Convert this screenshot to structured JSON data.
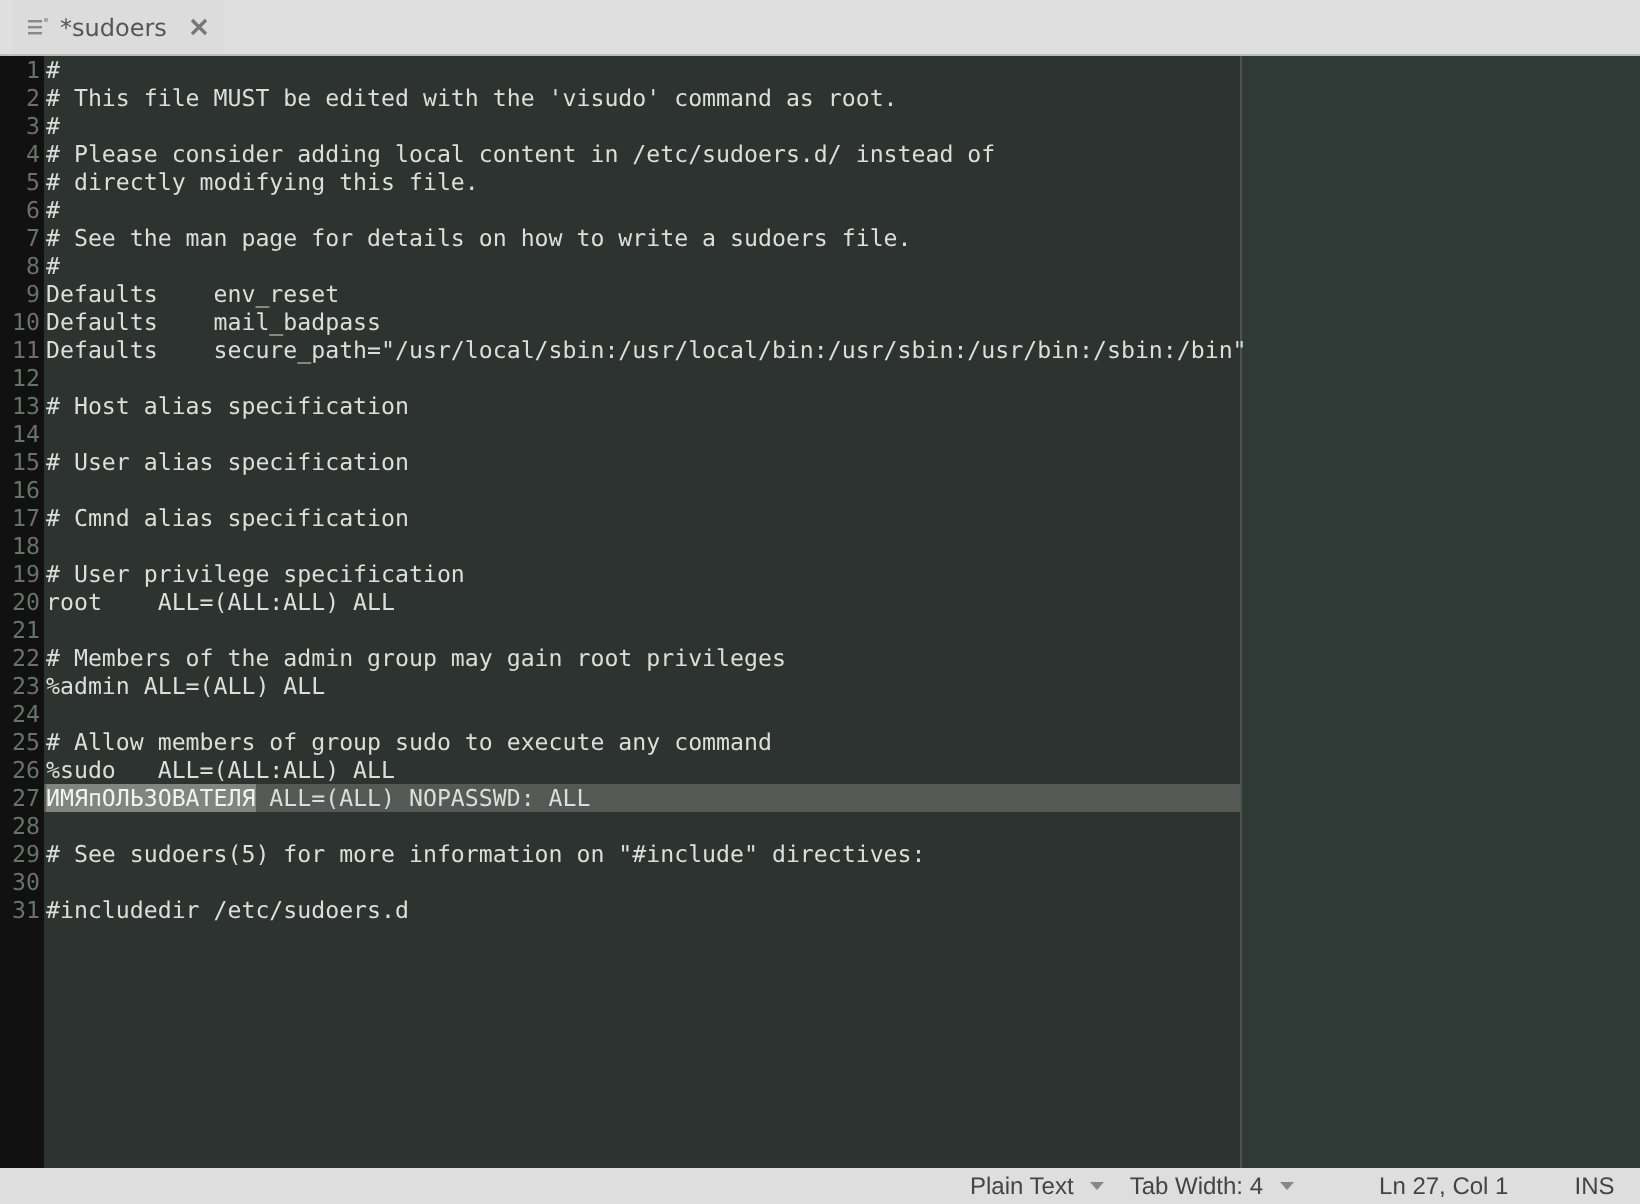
{
  "tab": {
    "title": "*sudoers",
    "modified": true
  },
  "lines": [
    {
      "number": "1",
      "text": "#",
      "current": false
    },
    {
      "number": "2",
      "text": "# This file MUST be edited with the 'visudo' command as root.",
      "current": false
    },
    {
      "number": "3",
      "text": "#",
      "current": false
    },
    {
      "number": "4",
      "text": "# Please consider adding local content in /etc/sudoers.d/ instead of",
      "current": false
    },
    {
      "number": "5",
      "text": "# directly modifying this file.",
      "current": false
    },
    {
      "number": "6",
      "text": "#",
      "current": false
    },
    {
      "number": "7",
      "text": "# See the man page for details on how to write a sudoers file.",
      "current": false
    },
    {
      "number": "8",
      "text": "#",
      "current": false
    },
    {
      "number": "9",
      "text": "Defaults    env_reset",
      "current": false
    },
    {
      "number": "10",
      "text": "Defaults    mail_badpass",
      "current": false
    },
    {
      "number": "11",
      "text": "Defaults    secure_path=\"/usr/local/sbin:/usr/local/bin:/usr/sbin:/usr/bin:/sbin:/bin\"",
      "current": false
    },
    {
      "number": "12",
      "current": false
    },
    {
      "number": "13",
      "text": "# Host alias specification",
      "current": false
    },
    {
      "number": "14",
      "current": false
    },
    {
      "number": "15",
      "text": "# User alias specification",
      "current": false
    },
    {
      "number": "16",
      "current": false
    },
    {
      "number": "17",
      "text": "# Cmnd alias specification",
      "current": false
    },
    {
      "number": "18",
      "current": false
    },
    {
      "number": "19",
      "text": "# User privilege specification",
      "current": false
    },
    {
      "number": "20",
      "text": "root    ALL=(ALL:ALL) ALL",
      "current": false
    },
    {
      "number": "21",
      "current": false
    },
    {
      "number": "22",
      "text": "# Members of the admin group may gain root privileges",
      "current": false
    },
    {
      "number": "23",
      "text": "%admin ALL=(ALL) ALL",
      "current": false
    },
    {
      "number": "24",
      "current": false
    },
    {
      "number": "25",
      "text": "# Allow members of group sudo to execute any command",
      "current": false
    },
    {
      "number": "26",
      "text": "%sudo   ALL=(ALL:ALL) ALL",
      "current": false
    },
    {
      "number": "27",
      "selected_text": "ИМЯпОЛЬЗОВАТЕЛЯ",
      "text": " ALL=(ALL) NOPASSWD: ALL",
      "current": true
    },
    {
      "number": "28",
      "current": false
    },
    {
      "number": "29",
      "text": "# See sudoers(5) for more information on \"#include\" directives:",
      "current": false
    },
    {
      "number": "30",
      "current": false
    },
    {
      "number": "31",
      "text": "#includedir /etc/sudoers.d",
      "current": false
    }
  ],
  "status_bar": {
    "language": "Plain Text",
    "tab_width": "Tab Width: 4",
    "position": "Ln 27, Col 1",
    "mode": "INS"
  }
}
